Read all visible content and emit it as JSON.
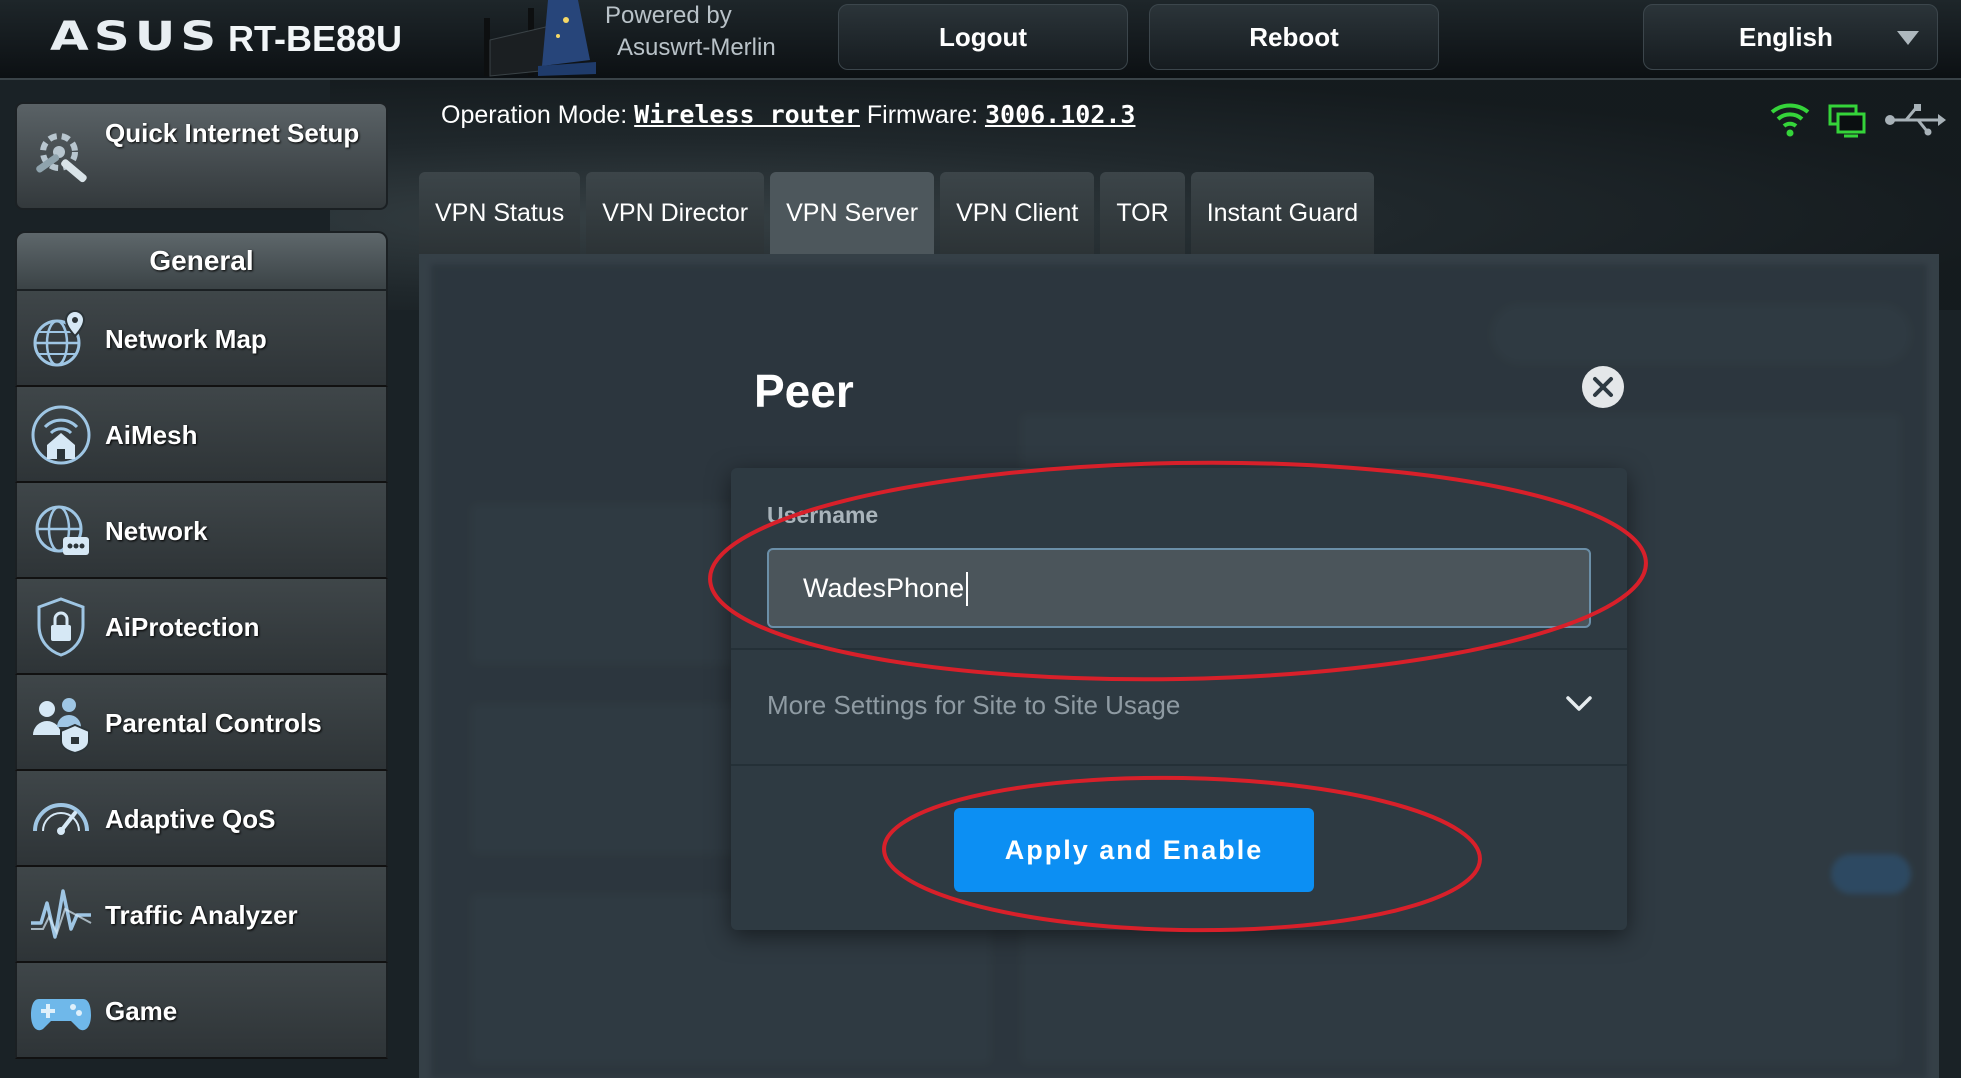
{
  "header": {
    "brand": "ASUS",
    "model": "RT-BE88U",
    "powered_by_line1": "Powered by",
    "powered_by_line2": "Asuswrt-Merlin",
    "logout_label": "Logout",
    "reboot_label": "Reboot",
    "language": "English"
  },
  "status": {
    "operation_mode_label": "Operation Mode:",
    "operation_mode_value": "Wireless router",
    "firmware_label": "Firmware:",
    "firmware_value": "3006.102.3"
  },
  "sidebar": {
    "quick_setup_label": "Quick Internet Setup",
    "section_title": "General",
    "items": [
      {
        "label": "Network Map",
        "icon": "globe-pin-icon"
      },
      {
        "label": "AiMesh",
        "icon": "mesh-house-icon"
      },
      {
        "label": "Network",
        "icon": "globe-network-icon"
      },
      {
        "label": "AiProtection",
        "icon": "shield-lock-icon"
      },
      {
        "label": "Parental Controls",
        "icon": "family-icon"
      },
      {
        "label": "Adaptive QoS",
        "icon": "gauge-icon"
      },
      {
        "label": "Traffic Analyzer",
        "icon": "waveform-icon"
      },
      {
        "label": "Game",
        "icon": "gamepad-icon"
      }
    ]
  },
  "tabs": [
    {
      "label": "VPN Status",
      "active": false
    },
    {
      "label": "VPN Director",
      "active": false
    },
    {
      "label": "VPN Server",
      "active": true
    },
    {
      "label": "VPN Client",
      "active": false
    },
    {
      "label": "TOR",
      "active": false
    },
    {
      "label": "Instant Guard",
      "active": false
    }
  ],
  "modal": {
    "title": "Peer",
    "username_label": "Username",
    "username_value": "WadesPhone",
    "more_settings_label": "More Settings for Site to Site Usage",
    "apply_label": "Apply and Enable"
  },
  "colors": {
    "accent": "#0c8ff3",
    "annotation": "#d8202a",
    "status_ok": "#35d43a"
  }
}
